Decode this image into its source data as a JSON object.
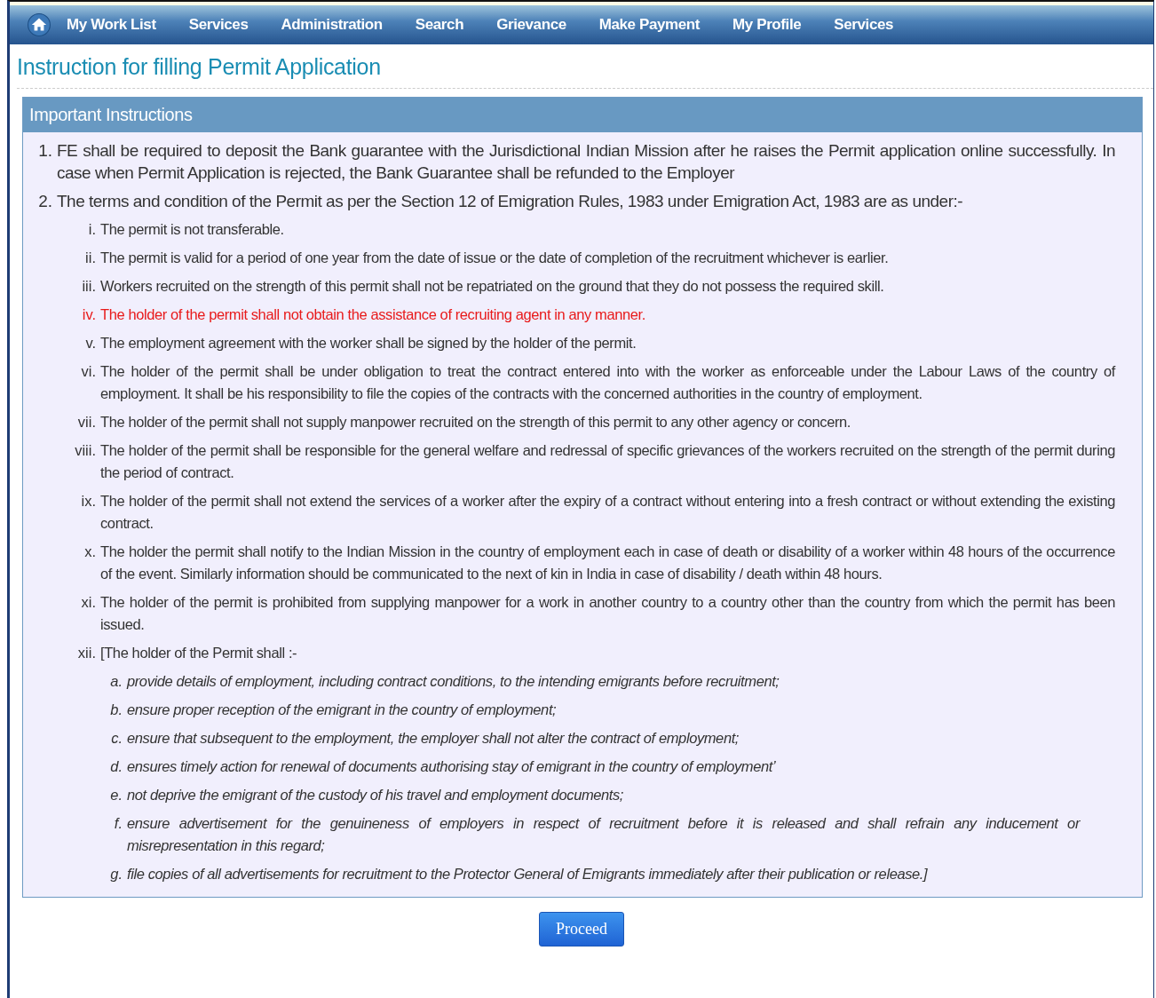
{
  "nav": {
    "items": [
      {
        "label": "My Work List"
      },
      {
        "label": "Services"
      },
      {
        "label": "Administration"
      },
      {
        "label": "Search"
      },
      {
        "label": "Grievance"
      },
      {
        "label": "Make Payment"
      },
      {
        "label": "My Profile"
      },
      {
        "label": "Services"
      }
    ]
  },
  "page_title": "Instruction for filling Permit Application",
  "panel": {
    "heading": "Important Instructions",
    "items": [
      {
        "marker": "1.",
        "text": "FE shall be required to deposit the Bank guarantee with the Jurisdictional Indian Mission after he raises the Permit application online successfully. In case when Permit Application is rejected, the Bank Guarantee shall be refunded to the Employer"
      },
      {
        "marker": "2.",
        "text": "The terms and condition of the Permit as per the Section 12 of Emigration Rules, 1983 under Emigration Act, 1983 are as under:-",
        "children": [
          {
            "marker": "i.",
            "text": "The permit is not transferable.",
            "highlighted": false
          },
          {
            "marker": "ii.",
            "text": "The permit is valid for a period of one year from the date of issue or the date of completion of the recruitment whichever is earlier.",
            "highlighted": false
          },
          {
            "marker": "iii.",
            "text": "Workers recruited on the strength of this permit shall not be repatriated on the ground that they do not possess the required skill.",
            "highlighted": false
          },
          {
            "marker": "iv.",
            "text": "The holder of the permit shall not obtain the assistance of recruiting agent in any manner.",
            "highlighted": true
          },
          {
            "marker": "v.",
            "text": "The employment agreement with the worker shall be signed by the holder of the permit.",
            "highlighted": false
          },
          {
            "marker": "vi.",
            "text": "The holder of the permit shall be under obligation to treat the contract entered into with the worker as enforceable under the Labour Laws of the country of employment. It shall be his responsibility to file the copies of the contracts with the concerned authorities in the country of employment.",
            "highlighted": false
          },
          {
            "marker": "vii.",
            "text": "The holder of the permit shall not supply manpower recruited on the strength of this permit to any other agency or concern.",
            "highlighted": false
          },
          {
            "marker": "viii.",
            "text": "The holder of the permit shall be responsible for the general welfare and redressal of specific grievances of the workers recruited on the strength of the permit during the period of contract.",
            "highlighted": false
          },
          {
            "marker": "ix.",
            "text": "The holder of the permit shall not extend the services of a worker after the expiry of a contract without entering into a fresh contract or without extending the existing contract.",
            "highlighted": false
          },
          {
            "marker": "x.",
            "text": "The holder the permit shall notify to the Indian Mission in the country of employment each in case of death or disability of a worker within 48 hours of the occurrence of the event. Similarly information should be communicated to the next of kin in India in case of disability / death within 48 hours.",
            "highlighted": false
          },
          {
            "marker": "xi.",
            "text": "The holder of the permit is prohibited from supplying manpower for a work in another country to a country other than the country from which the permit has been issued.",
            "highlighted": false
          },
          {
            "marker": "xii.",
            "text": "[The holder of the Permit shall :-",
            "highlighted": false,
            "children": [
              {
                "marker": "a.",
                "text": "provide details of employment, including contract conditions, to the intending emigrants before recruitment;"
              },
              {
                "marker": "b.",
                "text": "ensure proper reception of the emigrant in the country of employment;"
              },
              {
                "marker": "c.",
                "text": "ensure that subsequent to the employment, the employer shall not alter the contract of employment;"
              },
              {
                "marker": "d.",
                "text": "ensures timely action for renewal of documents authorising stay of emigrant in the country of employment’"
              },
              {
                "marker": "e.",
                "text": "not deprive the emigrant of the custody of his travel and employment documents;"
              },
              {
                "marker": "f.",
                "text": "ensure advertisement for the genuineness of employers in respect of recruitment before it is released and shall refrain any inducement or misrepresentation in this regard;"
              },
              {
                "marker": "g.",
                "text": "file copies of all advertisements for recruitment to the Protector General of Emigrants immediately after their publication or release.]"
              }
            ]
          }
        ]
      }
    ]
  },
  "proceed_button": "Proceed"
}
